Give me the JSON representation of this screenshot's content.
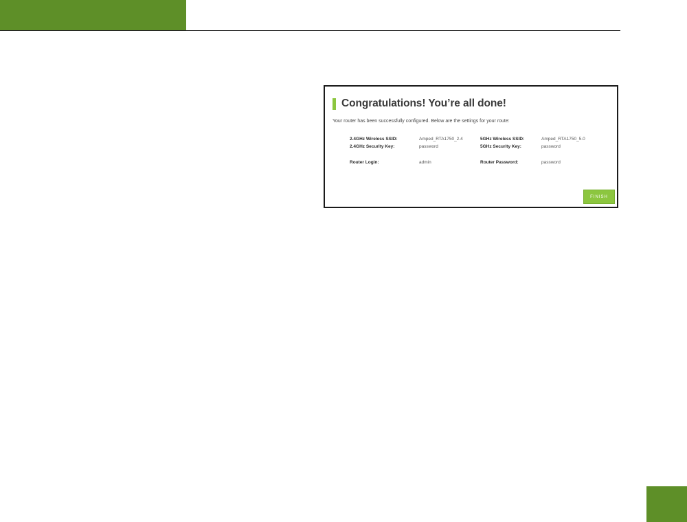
{
  "header": {
    "accent_color": "#5e8f28"
  },
  "wizard": {
    "title": "Congratulations! You’re all done!",
    "intro": "Your router has been successfully configured. Below are the settings for your route:",
    "fields": {
      "ssid24_label": "2.4GHz Wireless SSID:",
      "ssid24_value": "Amped_RTA1750_2.4",
      "key24_label": "2.4GHz Security Key:",
      "key24_value": "password",
      "ssid5_label": "5GHz Wireless SSID:",
      "ssid5_value": "Amped_RTA1750_5.0",
      "key5_label": "5GHz Security Key:",
      "key5_value": "password",
      "login_label": "Router Login:",
      "login_value": "admin",
      "password_label": "Router Password:",
      "password_value": "password"
    },
    "finish_label": "FINISH",
    "accent_color": "#8cc63f"
  }
}
